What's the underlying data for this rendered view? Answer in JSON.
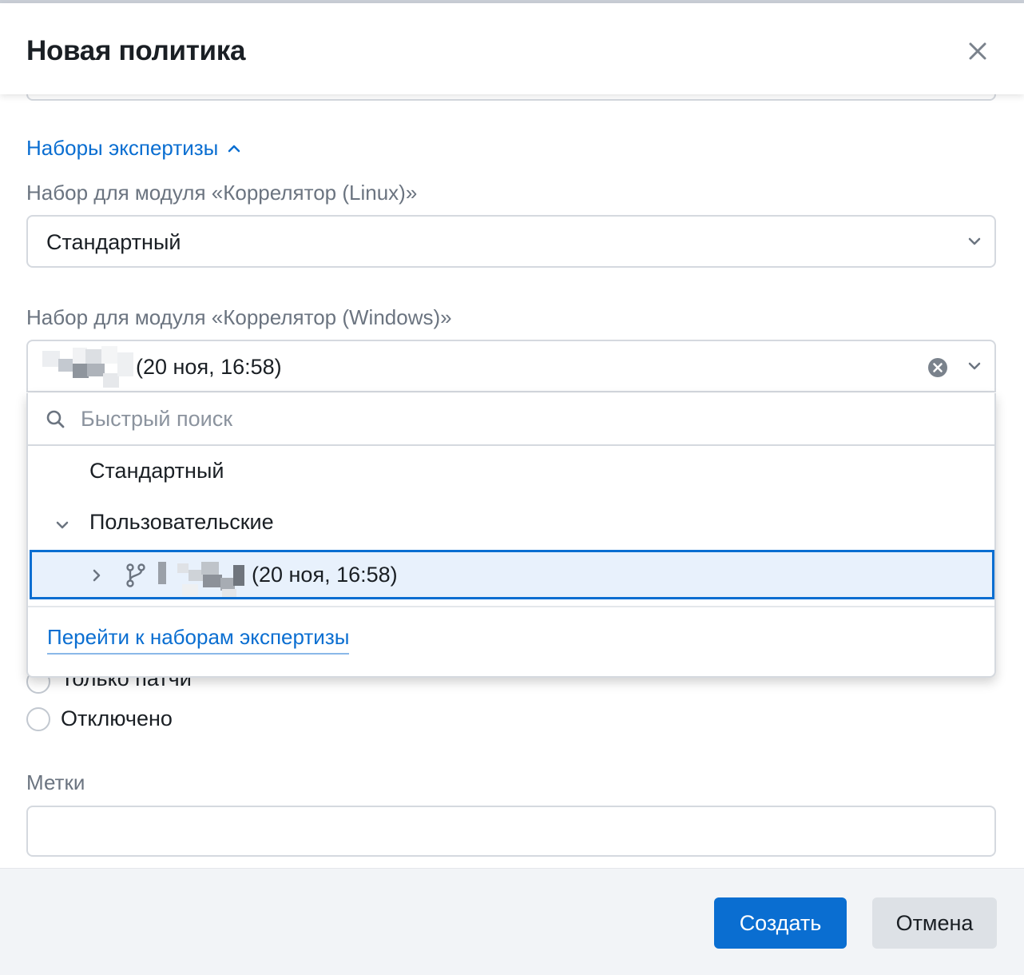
{
  "dialog": {
    "title": "Новая политика"
  },
  "section": {
    "label": "Наборы экспертизы"
  },
  "linux_field": {
    "label": "Набор для модуля «Коррелятор (Linux)»",
    "value": "Стандартный"
  },
  "windows_field": {
    "label": "Набор для модуля «Коррелятор (Windows)»",
    "value": "(20 ноя, 16:58)"
  },
  "dropdown": {
    "search_placeholder": "Быстрый поиск",
    "options": [
      {
        "label": "Стандартный"
      },
      {
        "label": "Пользовательские"
      }
    ],
    "selected_child": "(20 ноя, 16:58)",
    "goto_link": "Перейти к наборам экспертизы"
  },
  "radios": [
    {
      "label": "Только патчи"
    },
    {
      "label": "Отключено"
    }
  ],
  "tags_field": {
    "label": "Метки",
    "value": ""
  },
  "footer": {
    "create_label": "Создать",
    "cancel_label": "Отмена"
  },
  "colors": {
    "accent": "#0a6ed1",
    "selected_bg": "#e8f1fc",
    "footer_bg": "#f2f4f7"
  }
}
